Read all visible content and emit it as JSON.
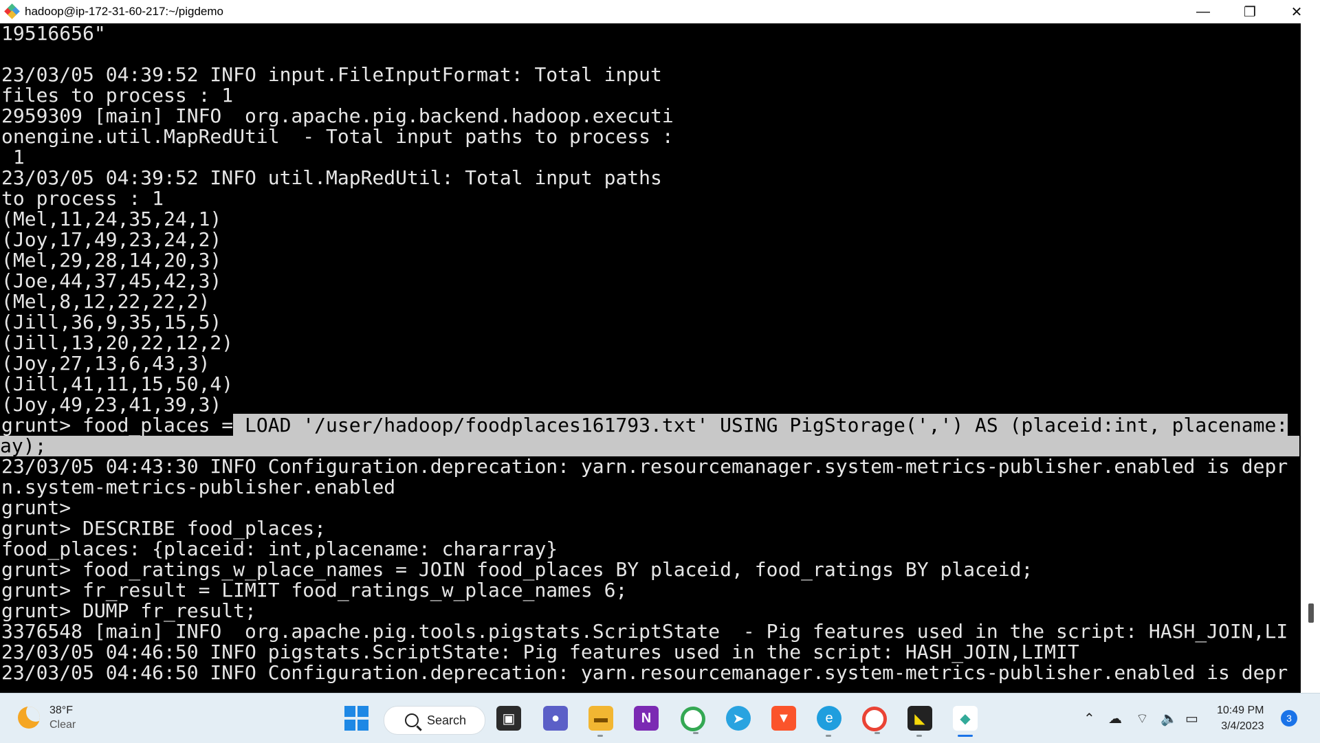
{
  "window": {
    "title": "hadoop@ip-172-31-60-217:~/pigdemo",
    "controls": {
      "minimize": "—",
      "restore": "❐",
      "close": "✕"
    }
  },
  "terminal": {
    "lines": [
      "19516656\"",
      "",
      "23/03/05 04:39:52 INFO input.FileInputFormat: Total input",
      "files to process : 1",
      "2959309 [main] INFO  org.apache.pig.backend.hadoop.executi",
      "onengine.util.MapRedUtil  - Total input paths to process :",
      " 1",
      "23/03/05 04:39:52 INFO util.MapRedUtil: Total input paths",
      "to process : 1",
      "(Mel,11,24,35,24,1)",
      "(Joy,17,49,23,24,2)",
      "(Mel,29,28,14,20,3)",
      "(Joe,44,37,45,42,3)",
      "(Mel,8,12,22,22,2)",
      "(Jill,36,9,35,15,5)",
      "(Jill,13,20,22,12,2)",
      "(Joy,27,13,6,43,3)",
      "(Jill,41,11,15,50,4)",
      "(Joy,49,23,41,39,3)",
      "",
      "",
      "23/03/05 04:43:30 INFO Configuration.deprecation: yarn.resourcemanager.system-metrics-publisher.enabled is depr",
      "n.system-metrics-publisher.enabled",
      "grunt>",
      "grunt> DESCRIBE food_places;",
      "food_places: {placeid: int,placename: chararray}",
      "grunt> food_ratings_w_place_names = JOIN food_places BY placeid, food_ratings BY placeid;",
      "grunt> fr_result = LIMIT food_ratings_w_place_names 6;",
      "grunt> DUMP fr_result;",
      "3376548 [main] INFO  org.apache.pig.tools.pigstats.ScriptState  - Pig features used in the script: HASH_JOIN,LI",
      "23/03/05 04:46:50 INFO pigstats.ScriptState: Pig features used in the script: HASH_JOIN,LIMIT",
      "23/03/05 04:46:50 INFO Configuration.deprecation: yarn.resourcemanager.system-metrics-publisher.enabled is depr"
    ],
    "load_line": {
      "prefix": "grunt> food_places =",
      "selected": " LOAD '/user/hadoop/foodplaces161793.txt' USING PigStorage(',') AS (placeid:int, placename:"
    },
    "load_line_cont": "ay);"
  },
  "taskbar": {
    "weather": {
      "temp": "38°F",
      "condition": "Clear"
    },
    "search_label": "Search",
    "clock": {
      "time": "10:49 PM",
      "date": "3/4/2023"
    },
    "notifications": "3"
  }
}
